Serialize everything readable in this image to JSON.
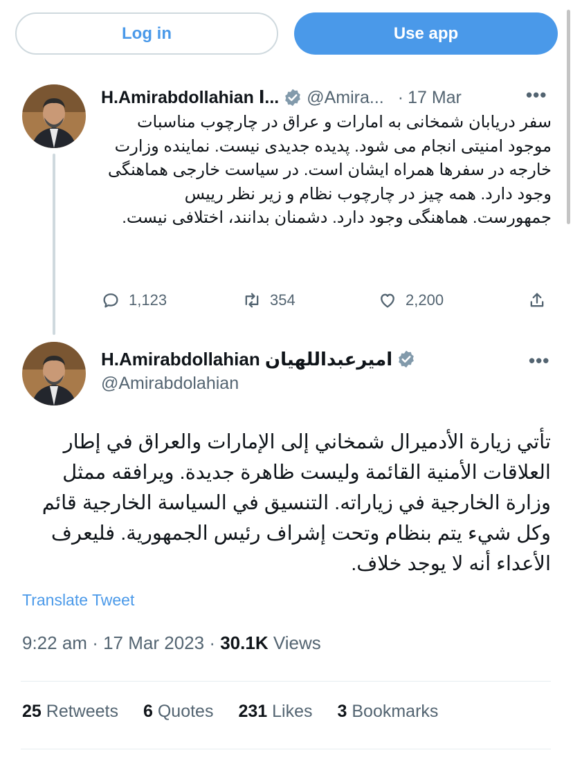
{
  "topbar": {
    "login_label": "Log in",
    "useapp_label": "Use app"
  },
  "tweet1": {
    "name": "H.Amirabdollahian ا...",
    "handle": "@Amira...",
    "separator": "·",
    "date": "17 Mar",
    "more": "•••",
    "text": "سفر دریابان شمخانی به امارات و عراق در چارچوب مناسبات موجود امنیتی انجام می شود. پدیده جدیدی نیست. نماینده وزارت خارجه در سفرها همراه ایشان است. در سیاست خارجی هماهنگی وجود دارد. همه چیز در چارچوب نظام و زیر نظر رییس جمهورست. هماهنگی وجود دارد. دشمنان بدانند، اختلافی نیست.",
    "replies": "1,123",
    "retweets": "354",
    "likes": "2,200"
  },
  "tweet2": {
    "name": "H.Amirabdollahian اميرعبداللهيان",
    "handle": "@Amirabdolahian",
    "more": "•••",
    "text": "تأتي زيارة الأدميرال شمخاني إلى الإمارات والعراق في إطار العلاقات الأمنية القائمة وليست ظاهرة جديدة. ويرافقه ممثل وزارة الخارجية في زياراته. التنسيق في السياسة الخارجية قائم وكل شيء يتم بنظام وتحت إشراف رئيس الجمهورية. فليعرف الأعداء أنه لا يوجد خلاف.",
    "translate_label": "Translate Tweet",
    "time": "9:22 am",
    "separator": "·",
    "full_date": "17 Mar 2023",
    "views_count": "30.1K",
    "views_label": "Views",
    "stats": {
      "retweets_count": "25",
      "retweets_label": "Retweets",
      "quotes_count": "6",
      "quotes_label": "Quotes",
      "likes_count": "231",
      "likes_label": "Likes",
      "bookmarks_count": "3",
      "bookmarks_label": "Bookmarks"
    }
  },
  "colors": {
    "accent": "#4a99e9",
    "secondary_text": "#536471",
    "primary_text": "#0f1419",
    "border": "#cfd9de",
    "verified_badge": "#829aab"
  },
  "icons": {
    "reply": "reply-icon",
    "retweet": "retweet-icon",
    "like": "heart-icon",
    "share": "share-icon",
    "verified": "verified-badge-icon"
  }
}
